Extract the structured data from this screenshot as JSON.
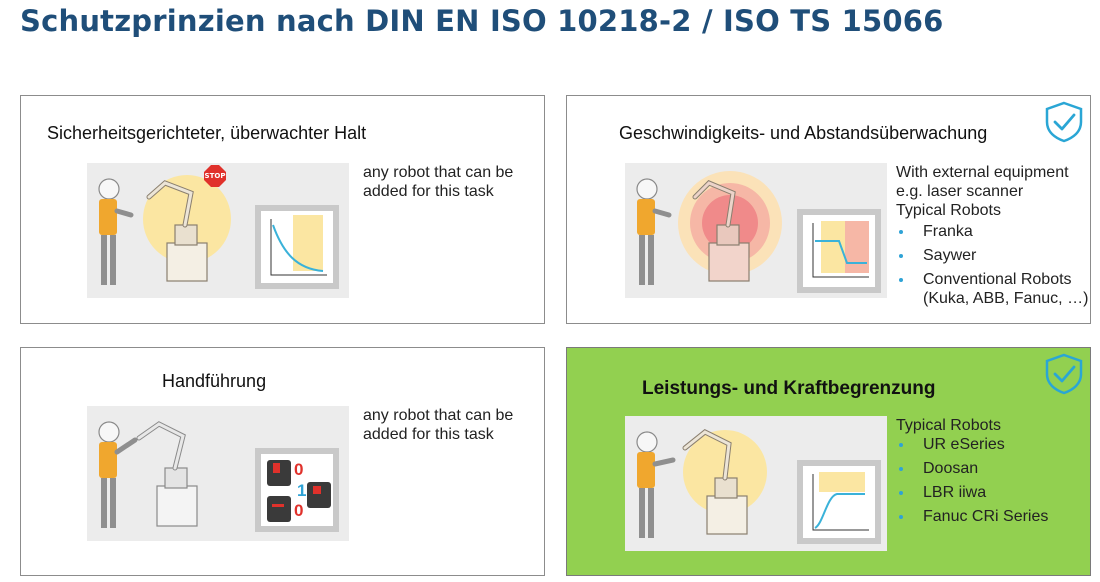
{
  "title": "Schutzprinzien nach DIN EN ISO 10218-2 / ISO TS 15066",
  "cards": [
    {
      "title": "Sicherheitsgerichteter, überwachter Halt",
      "note_line1": "any robot that can be",
      "note_line2": "added for this task",
      "stop_sign": "STOP",
      "icon": "stop-sign-icon"
    },
    {
      "title": "Geschwindigkeits- und Abstandsüberwachung",
      "intro_line1": "With external equipment",
      "intro_line2": "e.g. laser scanner",
      "list_head": "Typical Robots",
      "items": [
        "Franka",
        "Saywer",
        "Conventional Robots"
      ],
      "items_sub": "(Kuka, ABB, Fanuc, …)",
      "badge_icon": "shield-check-icon"
    },
    {
      "title": "Handführung",
      "note_line1": "any robot that can be",
      "note_line2": "added for this task",
      "switch_labels": [
        "0",
        "1",
        "0"
      ],
      "icon": "enabling-switch-icon"
    },
    {
      "title": "Leistungs- und Kraftbegrenzung",
      "list_head": "Typical Robots",
      "items": [
        "UR eSeries",
        "Doosan",
        "LBR iiwa",
        "Fanuc CRi Series"
      ],
      "badge_icon": "shield-check-icon"
    }
  ],
  "colors": {
    "title": "#1f4e79",
    "green_card": "#92d050",
    "bullet": "#2fa3d6",
    "shield": "#2aa6d5",
    "worker_vest": "#f0a72e",
    "zone_yellow": "#fbe6a2",
    "zone_red": "#f08a8a",
    "switch_red": "#e0312b"
  }
}
